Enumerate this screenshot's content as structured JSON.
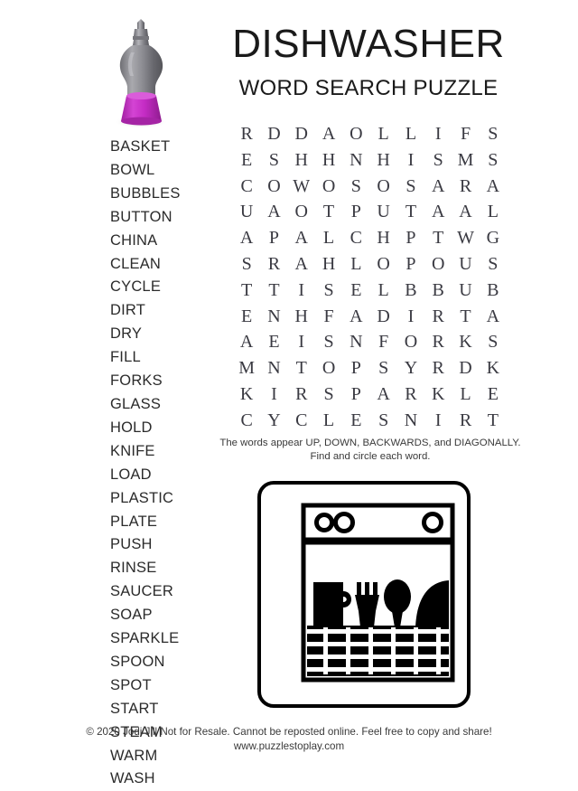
{
  "header": {
    "title": "DISHWASHER",
    "subtitle": "WORD SEARCH PUZZLE"
  },
  "word_list": {
    "words": [
      "BASKET",
      "BOWL",
      "BUBBLES",
      "BUTTON",
      "CHINA",
      "CLEAN",
      "CYCLE",
      "DIRT",
      "DRY",
      "FILL",
      "FORKS",
      "GLASS",
      "HOLD",
      "KNIFE",
      "LOAD",
      "PLASTIC",
      "PLATE",
      "PUSH",
      "RINSE",
      "SAUCER",
      "SOAP",
      "SPARKLE",
      "SPOON",
      "SPOT",
      "START",
      "STEAM",
      "WARM",
      "WASH"
    ]
  },
  "puzzle": {
    "rows": 12,
    "columns": 10,
    "grid": [
      [
        "R",
        "D",
        "D",
        "A",
        "O",
        "L",
        "L",
        "I",
        "F",
        "S"
      ],
      [
        "E",
        "S",
        "H",
        "H",
        "N",
        "H",
        "I",
        "S",
        "M",
        "S"
      ],
      [
        "C",
        "O",
        "W",
        "O",
        "S",
        "O",
        "S",
        "A",
        "R",
        "A"
      ],
      [
        "U",
        "A",
        "O",
        "T",
        "P",
        "U",
        "T",
        "A",
        "A",
        "L"
      ],
      [
        "A",
        "P",
        "A",
        "L",
        "C",
        "H",
        "P",
        "T",
        "W",
        "G"
      ],
      [
        "S",
        "R",
        "A",
        "H",
        "L",
        "O",
        "P",
        "O",
        "U",
        "S"
      ],
      [
        "T",
        "T",
        "I",
        "S",
        "E",
        "L",
        "B",
        "B",
        "U",
        "B"
      ],
      [
        "E",
        "N",
        "H",
        "F",
        "A",
        "D",
        "I",
        "R",
        "T",
        "A"
      ],
      [
        "A",
        "E",
        "I",
        "S",
        "N",
        "F",
        "O",
        "R",
        "K",
        "S"
      ],
      [
        "M",
        "N",
        "T",
        "O",
        "P",
        "S",
        "Y",
        "R",
        "D",
        "K"
      ],
      [
        "K",
        "I",
        "R",
        "S",
        "P",
        "A",
        "R",
        "K",
        "L",
        "E"
      ],
      [
        "C",
        "Y",
        "C",
        "L",
        "E",
        "S",
        "N",
        "I",
        "R",
        "T"
      ]
    ]
  },
  "instructions": {
    "line1": "The words appear UP, DOWN, BACKWARDS, and DIAGONALLY.",
    "line2": "Find and circle each word."
  },
  "footer": {
    "copyright": "© 2020 Jodi Jill Not for Resale. Cannot be reposted online. Feel free to copy and share!",
    "url": "www.puzzlestoplay.com"
  },
  "colors": {
    "bottle_body": "#8e8e93",
    "bottle_accent": "#c42cc4",
    "text": "#1a1a1a",
    "grid_letter": "#3a3a42",
    "illustration": "#000000"
  },
  "illustrations": {
    "bottle": "dish-soap-bottle",
    "dishwasher": "dishwasher-appliance"
  }
}
